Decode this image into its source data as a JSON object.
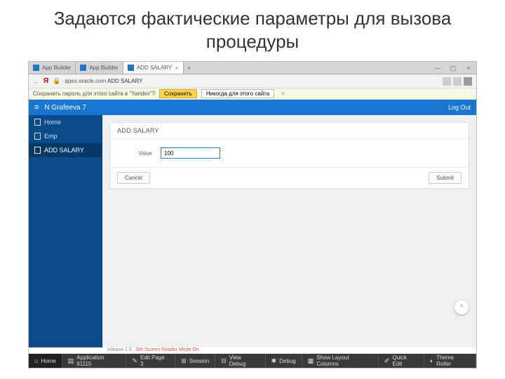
{
  "slide_title": "Задаются фактические параметры для вызова процедуры",
  "tabs": [
    {
      "label": "App Builder",
      "active": false
    },
    {
      "label": "App Builder",
      "active": false
    },
    {
      "label": "ADD SALARY",
      "active": true
    }
  ],
  "address": {
    "domain": "apex.oracle.com",
    "path": "ADD SALARY"
  },
  "pwbar": {
    "text": "Сохранить пароль для этого сайта в \"Yandex\"?",
    "save": "Сохранить",
    "never": "Никогда для этого сайта"
  },
  "app": {
    "title": "N Grafeeva 7",
    "logout": "Log Out"
  },
  "sidebar": [
    {
      "label": "Home",
      "active": false
    },
    {
      "label": "Emp",
      "active": false
    },
    {
      "label": "ADD SALARY",
      "active": true
    }
  ],
  "form": {
    "region_title": "ADD SALARY",
    "field_label": "Value",
    "field_value": "100",
    "cancel": "Cancel",
    "submit": "Submit"
  },
  "footer_release": "release 1.0",
  "footer_mode": "Set Screen Reader Mode On",
  "devbar": {
    "home": "Home",
    "app": "Application 91115",
    "edit": "Edit Page 3",
    "session": "Session",
    "view_debug": "View Debug",
    "debug": "Debug",
    "layout": "Show Layout Columns",
    "quick": "Quick Edit",
    "theme": "Theme Roller"
  }
}
